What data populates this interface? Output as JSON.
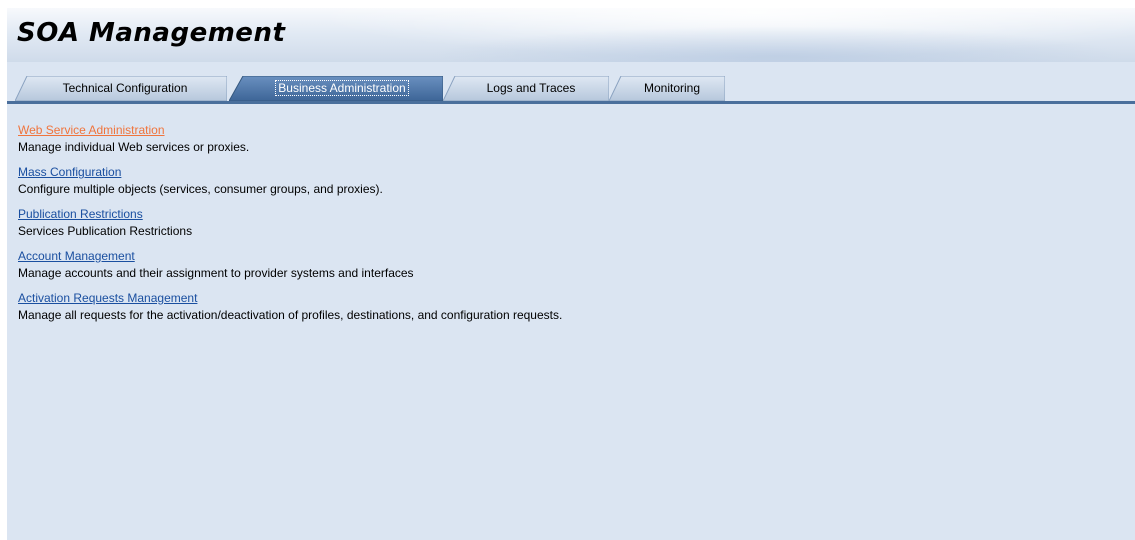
{
  "header": {
    "title": "SOA Management"
  },
  "tabs": [
    {
      "label": "Technical Configuration",
      "active": false
    },
    {
      "label": "Business Administration",
      "active": true
    },
    {
      "label": "Logs and Traces",
      "active": false
    },
    {
      "label": "Monitoring",
      "active": false
    }
  ],
  "entries": [
    {
      "link": "Web Service Administration",
      "description": "Manage individual Web services or proxies.",
      "visited": true
    },
    {
      "link": "Mass Configuration",
      "description": "Configure multiple objects (services, consumer groups, and proxies).",
      "visited": false
    },
    {
      "link": "Publication Restrictions",
      "description": "Services Publication Restrictions",
      "visited": false
    },
    {
      "link": "Account Management",
      "description": "Manage accounts and their assignment to provider systems and interfaces",
      "visited": false
    },
    {
      "link": "Activation Requests Management",
      "description": "Manage all requests for the activation/deactivation of profiles, destinations, and configuration requests.",
      "visited": false
    }
  ],
  "colors": {
    "background": "#dbe5f2",
    "link": "#1a4fa0",
    "visited_link": "#f0743c",
    "active_tab": "#4a72a6",
    "tab_underline": "#4a6f9c"
  }
}
